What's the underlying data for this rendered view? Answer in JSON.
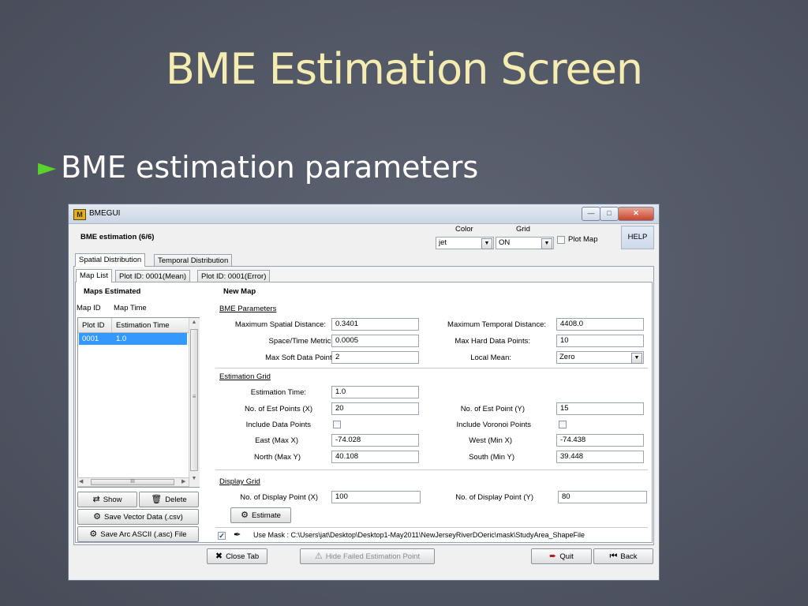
{
  "slide": {
    "title": "BME Estimation Screen",
    "bullet": "BME estimation parameters"
  },
  "window": {
    "title": "BMEGUI",
    "header": "BME estimation (6/6)",
    "color_label": "Color",
    "grid_label": "Grid",
    "color_value": "jet",
    "grid_value": "ON",
    "plot_map_label": "Plot Map",
    "plot_map_checked": false,
    "help_label": "HELP",
    "top_tabs": [
      "Spatial Distribution",
      "Temporal Distribution"
    ],
    "sub_tabs": [
      "Map List",
      "Plot ID: 0001(Mean)",
      "Plot ID: 0001(Error)"
    ],
    "left": {
      "maps_estimated": "Maps Estimated",
      "map_id": "Map ID",
      "map_time": "Map Time",
      "columns": [
        "Plot ID",
        "Estimation Time"
      ],
      "rows": [
        [
          "0001",
          "1.0"
        ]
      ],
      "scroll_mid": "III",
      "show_btn": "Show",
      "delete_btn": "Delete",
      "save_vector_btn": "Save Vector Data (.csv)",
      "save_arc_btn": "Save Arc ASCII (.asc) File"
    },
    "right": {
      "new_map": "New Map",
      "bme_params_title": "BME Parameters",
      "max_spatial_label": "Maximum Spatial Distance:",
      "max_spatial_value": "0.3401",
      "max_temporal_label": "Maximum Temporal Distance:",
      "max_temporal_value": "4408.0",
      "metric_label": "Space/Time Metric:",
      "metric_value": "0.0005",
      "max_hard_label": "Max Hard Data Points:",
      "max_hard_value": "10",
      "max_soft_label": "Max Soft Data Points:",
      "max_soft_value": "2",
      "local_mean_label": "Local Mean:",
      "local_mean_value": "Zero",
      "est_grid_title": "Estimation Grid",
      "est_time_label": "Estimation Time:",
      "est_time_value": "1.0",
      "est_x_label": "No. of Est Points (X)",
      "est_x_value": "20",
      "est_y_label": "No. of Est Point (Y)",
      "est_y_value": "15",
      "include_data_label": "Include Data Points",
      "include_voronoi_label": "Include Voronoi Points",
      "east_label": "East (Max X)",
      "east_value": "-74.028",
      "west_label": "West (Min X)",
      "west_value": "-74.438",
      "north_label": "North (Max Y)",
      "north_value": "40.108",
      "south_label": "South (Min Y)",
      "south_value": "39.448",
      "display_grid_title": "Display Grid",
      "disp_x_label": "No. of Display Point (X)",
      "disp_x_value": "100",
      "disp_y_label": "No. of Display Point (Y)",
      "disp_y_value": "80",
      "estimate_btn": "Estimate",
      "use_mask_label": "Use Mask : C:\\Users\\jat\\Desktop\\Desktop1-May2011\\NewJerseyRiverDOeric\\mask\\StudyArea_ShapeFile",
      "use_mask_checked": true
    },
    "bottom": {
      "close_tab": "Close Tab",
      "hide_failed": "Hide Failed Estimation Point",
      "quit": "Quit",
      "back": "Back"
    }
  }
}
